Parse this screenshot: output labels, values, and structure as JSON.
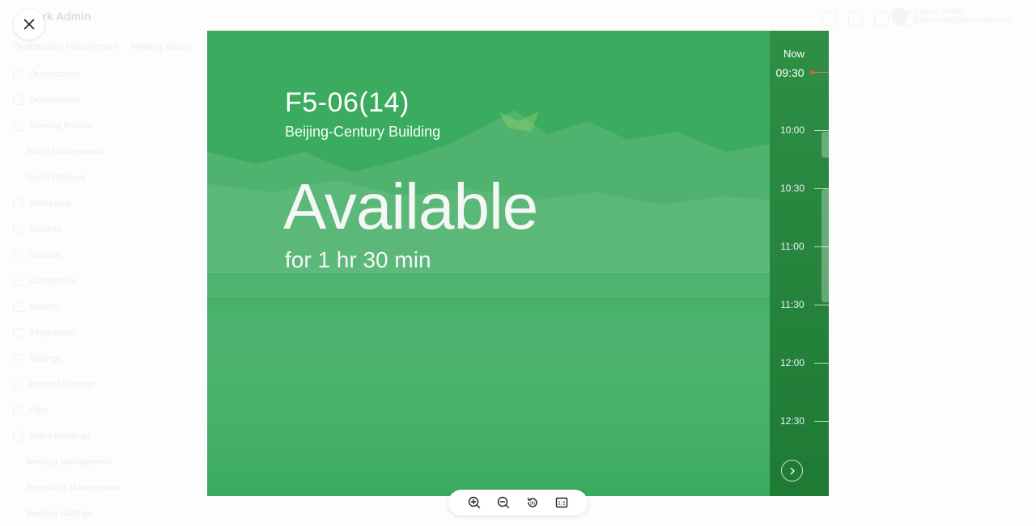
{
  "background_app": {
    "title": "Lark Admin",
    "user_name": "Lisbon Smith",
    "user_subtitle": "lisbonsmith@example.com",
    "breadcrumb": [
      "Organization Management",
      "Meeting Rooms"
    ],
    "nav_items": [
      {
        "label": "Organization",
        "sub": false
      },
      {
        "label": "Departments",
        "sub": false
      },
      {
        "label": "Meeting Rooms",
        "sub": false
      },
      {
        "label": "Room Management",
        "sub": true
      },
      {
        "label": "Room Displays",
        "sub": true
      },
      {
        "label": "Workplace",
        "sub": false
      },
      {
        "label": "Security",
        "sub": false
      },
      {
        "label": "Devices",
        "sub": false
      },
      {
        "label": "Compliance",
        "sub": false
      },
      {
        "label": "Reports",
        "sub": false
      },
      {
        "label": "Integrations",
        "sub": false
      },
      {
        "label": "Settings",
        "sub": false
      },
      {
        "label": "Product Settings",
        "sub": false
      },
      {
        "label": "Files",
        "sub": false
      },
      {
        "label": "Video Meetings",
        "sub": false
      },
      {
        "label": "Meeting Management",
        "sub": true
      },
      {
        "label": "Recording Management",
        "sub": true
      },
      {
        "label": "Meeting Settings",
        "sub": true
      }
    ]
  },
  "preview": {
    "room_name": "F5-06(14)",
    "location": "Beijing-Century Building",
    "status": "Available",
    "duration": "for 1 hr 30 min",
    "background_color": "#3bab5f",
    "timeline": {
      "now_label": "Now",
      "now_time": "09:30",
      "slots": [
        "10:00",
        "10:30",
        "11:00",
        "11:30",
        "12:00",
        "12:30"
      ]
    }
  },
  "toolbar": {
    "zoom_in": "zoom-in-icon",
    "zoom_out": "zoom-out-icon",
    "rotate": "rotate-icon",
    "actual_size_label": "1:1"
  }
}
